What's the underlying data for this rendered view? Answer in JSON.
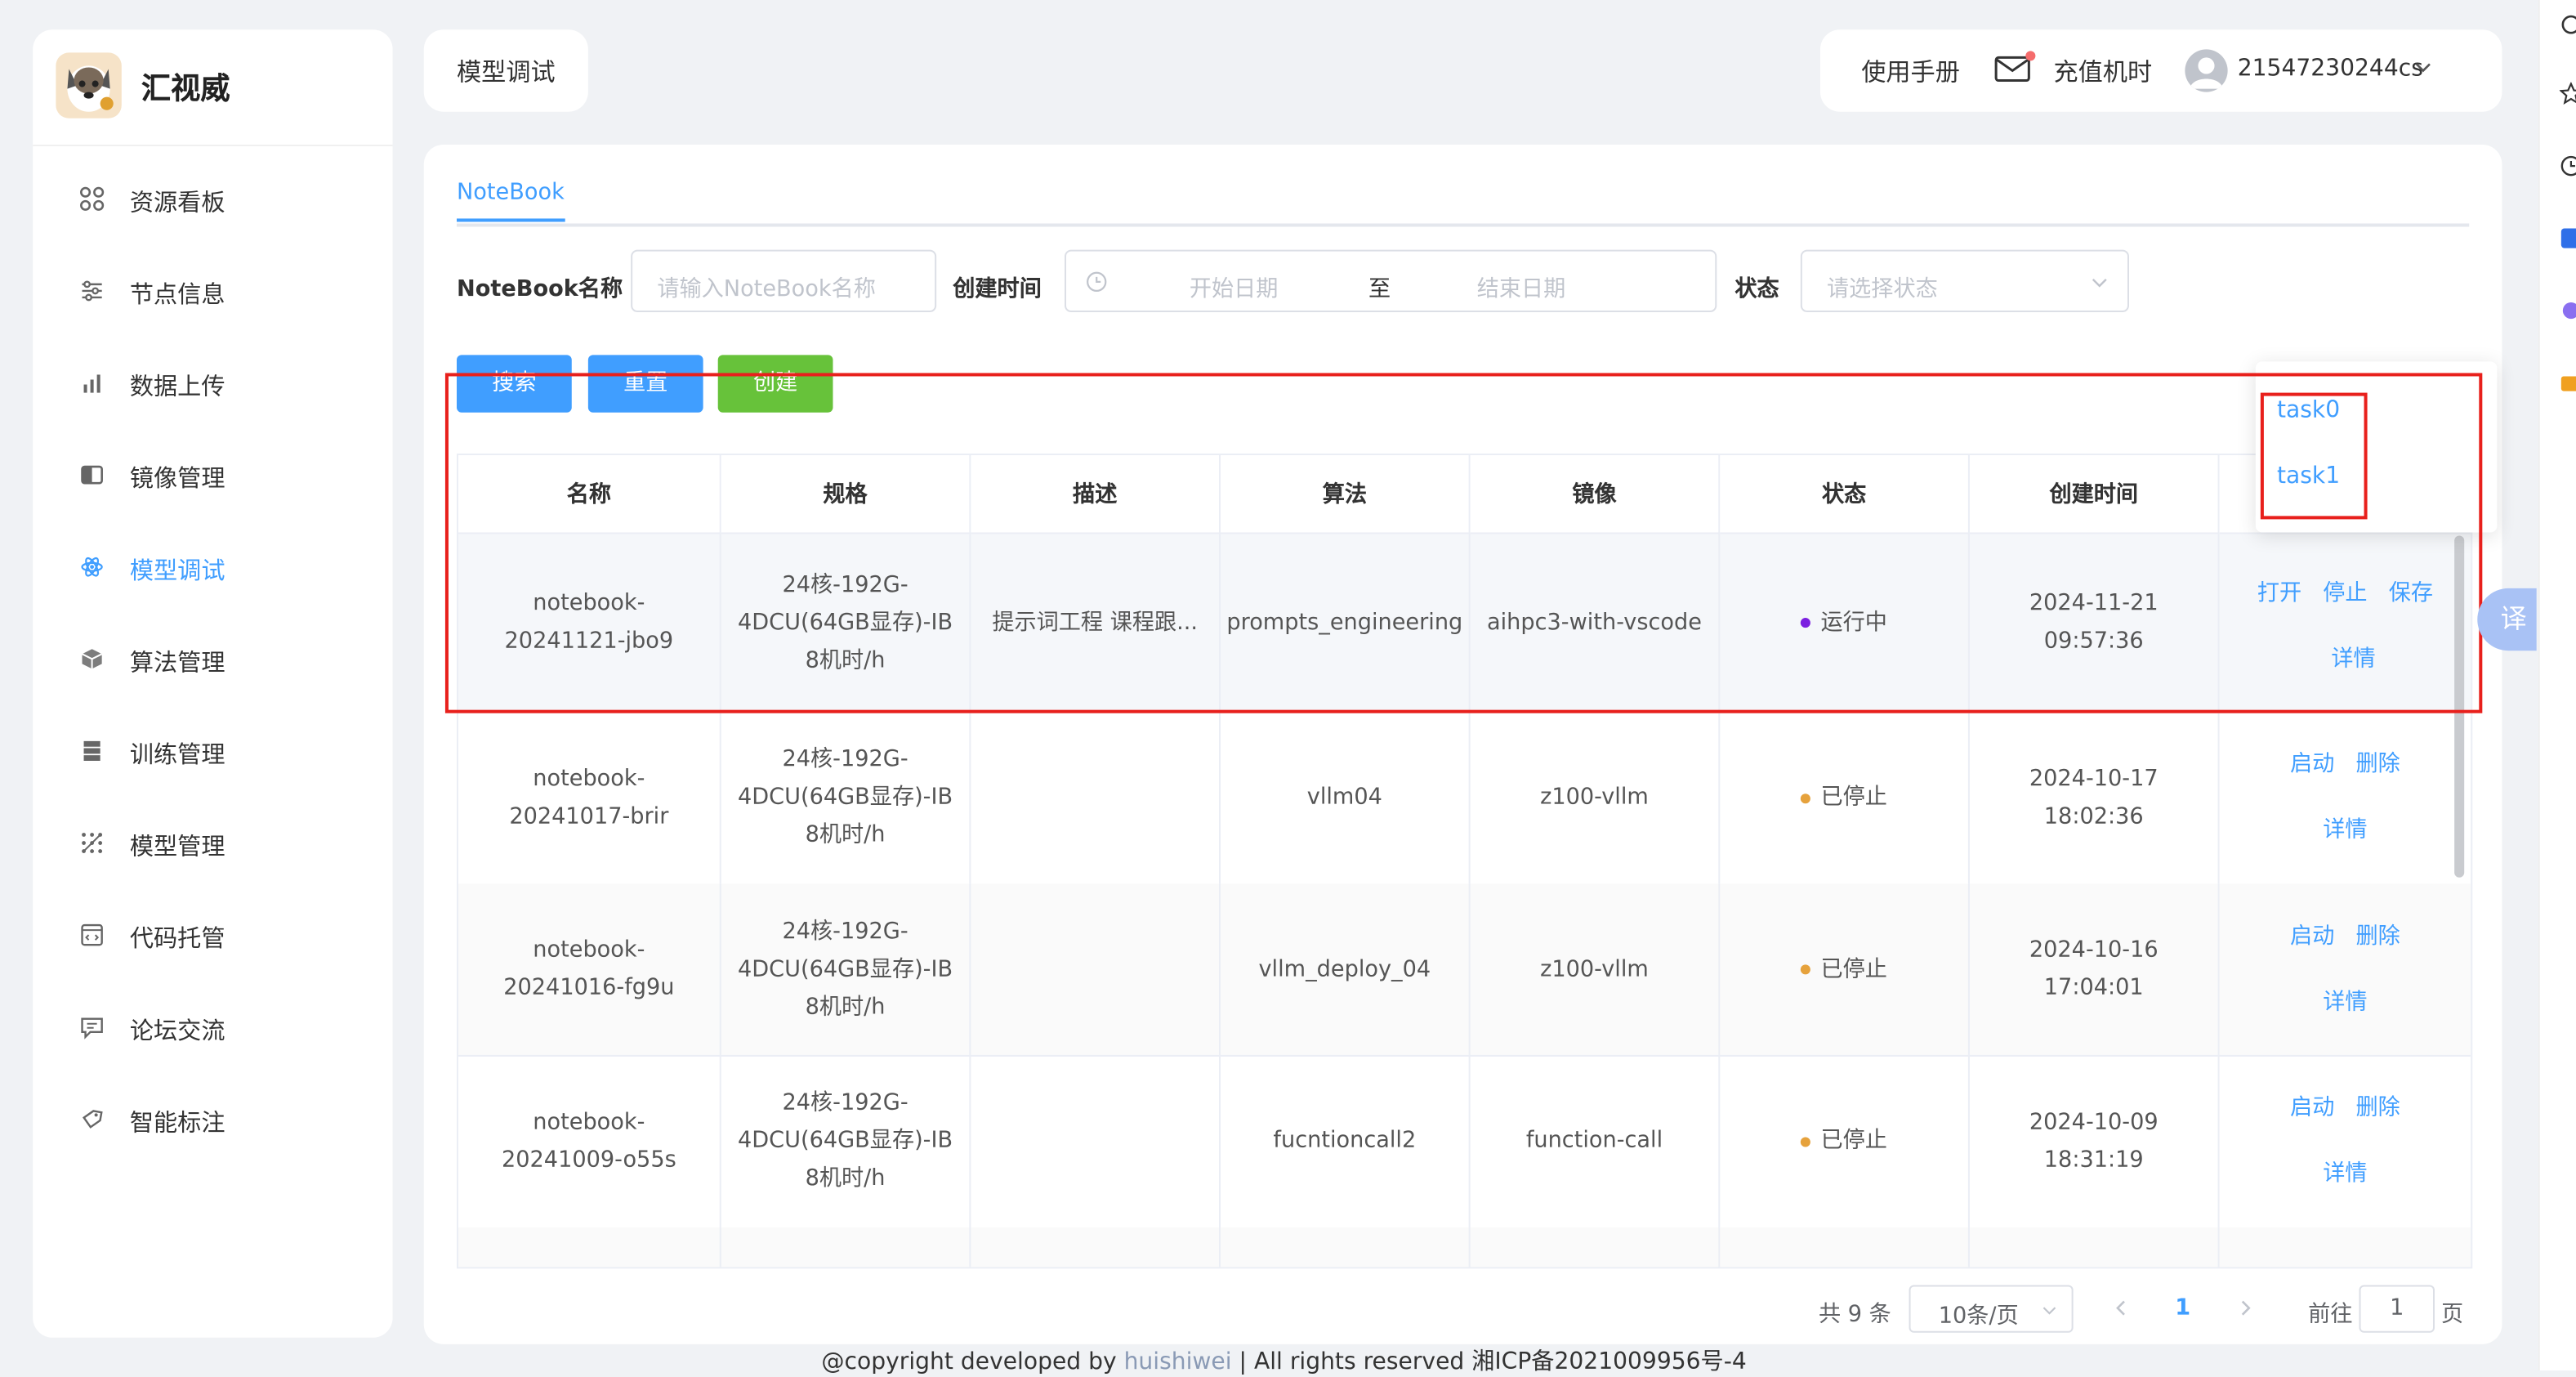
{
  "brand": {
    "name": "汇视威"
  },
  "sidebar": {
    "items": [
      {
        "label": "资源看板",
        "icon": "dashboard-icon"
      },
      {
        "label": "节点信息",
        "icon": "sliders-icon"
      },
      {
        "label": "数据上传",
        "icon": "bar-chart-icon"
      },
      {
        "label": "镜像管理",
        "icon": "image-icon"
      },
      {
        "label": "模型调试",
        "icon": "atom-icon",
        "active": true
      },
      {
        "label": "算法管理",
        "icon": "cube-icon"
      },
      {
        "label": "训练管理",
        "icon": "database-icon"
      },
      {
        "label": "模型管理",
        "icon": "scatter-icon"
      },
      {
        "label": "代码托管",
        "icon": "code-icon"
      },
      {
        "label": "论坛交流",
        "icon": "chat-icon"
      },
      {
        "label": "智能标注",
        "icon": "tag-icon"
      }
    ]
  },
  "header": {
    "page_tab": "模型调试",
    "manual": "使用手册",
    "recharge": "充值机时",
    "user": "21547230244cs"
  },
  "main": {
    "tab": "NoteBook",
    "filters": {
      "name_label": "NoteBook名称",
      "name_placeholder": "请输入NoteBook名称",
      "time_label": "创建时间",
      "start_placeholder": "开始日期",
      "range_sep": "至",
      "end_placeholder": "结束日期",
      "status_label": "状态",
      "status_placeholder": "请选择状态"
    },
    "buttons": {
      "search": "搜索",
      "reset": "重置",
      "create": "创建"
    },
    "table": {
      "columns": [
        "名称",
        "规格",
        "描述",
        "算法",
        "镜像",
        "状态",
        "创建时间"
      ],
      "rows": [
        {
          "name": "notebook-20241121-jbo9",
          "spec": "24核-192G-4DCU(64GB显存)-IB 8机时/h",
          "desc": "提示词工程 课程跟...",
          "algo": "prompts_engineering",
          "image": "aihpc3-with-vscode",
          "status": "运行中",
          "status_color": "#7b1fe0",
          "created": "2024-11-21 09:57:36",
          "ops": [
            "打开",
            "停止",
            "保存",
            "详情"
          ]
        },
        {
          "name": "notebook-20241017-brir",
          "spec": "24核-192G-4DCU(64GB显存)-IB 8机时/h",
          "desc": "",
          "algo": "vllm04",
          "image": "z100-vllm",
          "status": "已停止",
          "status_color": "#e6a23c",
          "created": "2024-10-17 18:02:36",
          "ops": [
            "启动",
            "删除",
            "详情"
          ]
        },
        {
          "name": "notebook-20241016-fg9u",
          "spec": "24核-192G-4DCU(64GB显存)-IB 8机时/h",
          "desc": "",
          "algo": "vllm_deploy_04",
          "image": "z100-vllm",
          "status": "已停止",
          "status_color": "#e6a23c",
          "created": "2024-10-16 17:04:01",
          "ops": [
            "启动",
            "删除",
            "详情"
          ]
        },
        {
          "name": "notebook-20241009-o55s",
          "spec": "24核-192G-4DCU(64GB显存)-IB 8机时/h",
          "desc": "",
          "algo": "fucntioncall2",
          "image": "function-call",
          "status": "已停止",
          "status_color": "#e6a23c",
          "created": "2024-10-09 18:31:19",
          "ops": [
            "启动",
            "删除",
            "详情"
          ]
        }
      ]
    },
    "dropdown": {
      "items": [
        "task0",
        "task1"
      ]
    },
    "pagination": {
      "total": "共 9 条",
      "page_size": "10条/页",
      "current": "1",
      "goto_label": "前往",
      "goto_value": "1",
      "page_unit": "页"
    }
  },
  "footer": {
    "prefix": "@copyright developed by ",
    "link": "huishiwei",
    "suffix": " | All rights reserved 湘ICP备2021009956号-4"
  },
  "translate": {
    "label": "译"
  },
  "colors": {
    "accent": "#409eff",
    "search_btn": "#409eff",
    "create_btn": "#67c23a",
    "highlight": "#e8201c"
  }
}
